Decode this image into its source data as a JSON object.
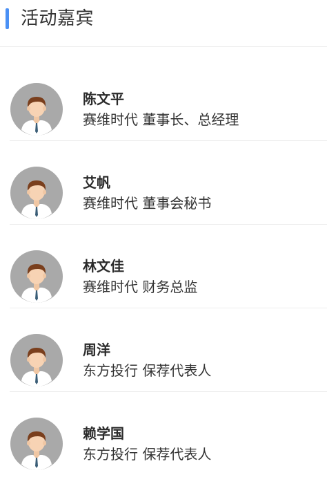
{
  "header": {
    "title": "活动嘉宾",
    "accent_color": "#4a90f5"
  },
  "guests": [
    {
      "name": "陈文平",
      "title": "赛维时代 董事长、总经理",
      "avatar_icon": "person-avatar-icon"
    },
    {
      "name": "艾帆",
      "title": "赛维时代 董事会秘书",
      "avatar_icon": "person-avatar-icon"
    },
    {
      "name": "林文佳",
      "title": "赛维时代 财务总监",
      "avatar_icon": "person-avatar-icon"
    },
    {
      "name": "周洋",
      "title": "东方投行 保荐代表人",
      "avatar_icon": "person-avatar-icon"
    },
    {
      "name": "赖学国",
      "title": "东方投行 保荐代表人",
      "avatar_icon": "person-avatar-icon"
    }
  ]
}
